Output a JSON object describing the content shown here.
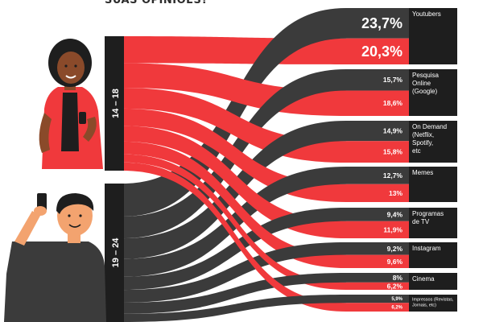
{
  "title_fragment": "SUAS OPINIÕES?",
  "colors": {
    "red": "#f0393c",
    "dark": "#3b3b3b",
    "black": "#1e1e1e",
    "white": "#ffffff",
    "skin": "#f3a36f",
    "skin_dark": "#8a4a2a"
  },
  "chart_data": {
    "type": "sankey",
    "title": "",
    "groups": [
      {
        "name": "14 – 18",
        "color": "#f0393c"
      },
      {
        "name": "19 – 24",
        "color": "#3b3b3b"
      }
    ],
    "categories": [
      {
        "label": "Youtubers",
        "value_19_24": "23,7%",
        "value_14_18": "20,3%",
        "big": true
      },
      {
        "label": "Pesquisa Online (Google)",
        "value_19_24": "15,7%",
        "value_14_18": "18,6%",
        "big": false
      },
      {
        "label": "On Demand (Netflix, Spotify, etc",
        "value_19_24": "14,9%",
        "value_14_18": "15,8%",
        "big": false
      },
      {
        "label": "Memes",
        "value_19_24": "12,7%",
        "value_14_18": "13%",
        "big": false
      },
      {
        "label": "Programas de TV",
        "value_19_24": "9,4%",
        "value_14_18": "11,9%",
        "big": false
      },
      {
        "label": "Instagram",
        "value_19_24": "9,2%",
        "value_14_18": "9,6%",
        "big": false
      },
      {
        "label": "Cinema",
        "value_19_24": "8%",
        "value_14_18": "6,2%",
        "big": false
      },
      {
        "label": "Impressos (Revistas, Jornais, etc)",
        "value_19_24": "5,9%",
        "value_14_18": "6,2%",
        "big": false,
        "tiny": true
      }
    ]
  }
}
